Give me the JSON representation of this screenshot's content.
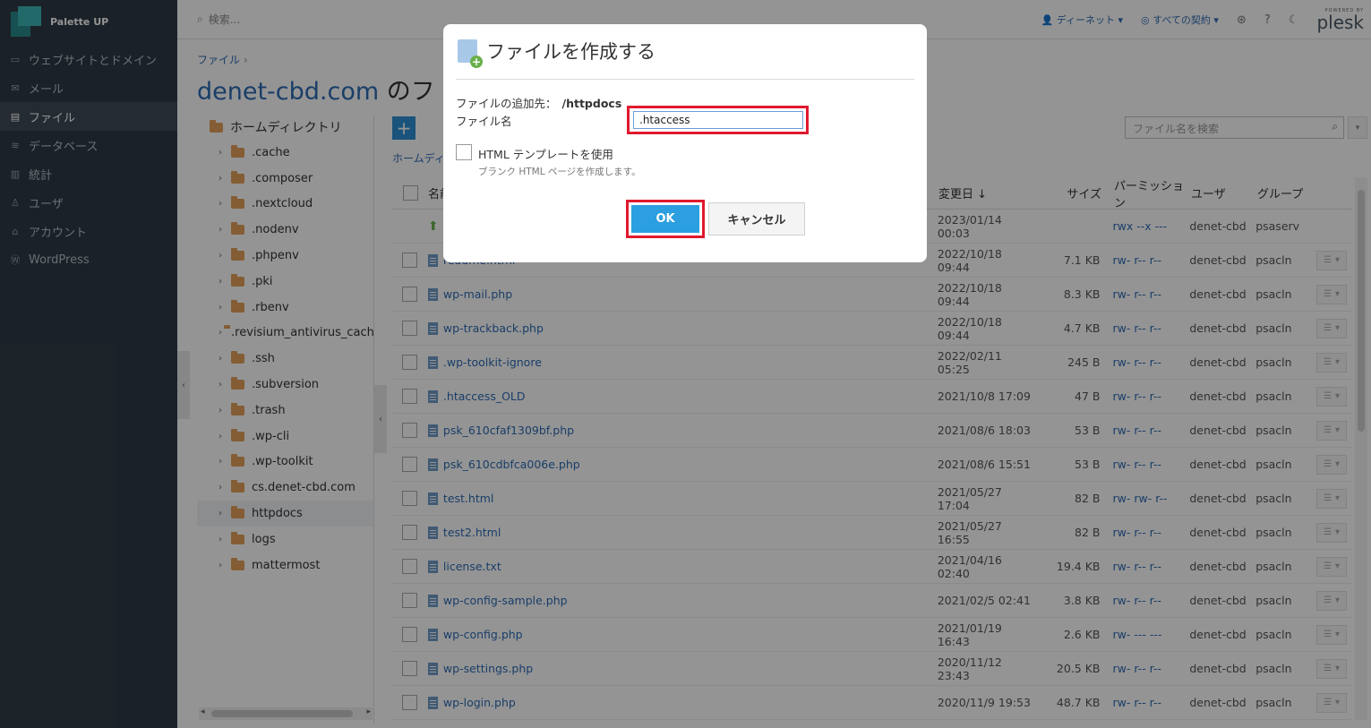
{
  "sidebar": {
    "brand": "Palette UP",
    "items": [
      {
        "icon": "monitor-icon",
        "label": "ウェブサイトとドメイン"
      },
      {
        "icon": "mail-icon",
        "label": "メール"
      },
      {
        "icon": "folder-icon",
        "label": "ファイル",
        "active": true
      },
      {
        "icon": "database-icon",
        "label": "データベース"
      },
      {
        "icon": "chart-icon",
        "label": "統計"
      },
      {
        "icon": "user-icon",
        "label": "ユーザ"
      },
      {
        "icon": "account-icon",
        "label": "アカウント"
      },
      {
        "icon": "wordpress-icon",
        "label": "WordPress"
      }
    ]
  },
  "topbar": {
    "search_placeholder": "検索...",
    "account": "ディーネット",
    "subscriptions": "すべての契約",
    "powered_by": "POWERED BY",
    "plesk": "plesk"
  },
  "main": {
    "breadcrumb": "ファイル",
    "title_domain": "denet-cbd.com",
    "title_rest": " のフ",
    "file_search_placeholder": "ファイル名を検索",
    "sub_breadcrumb": "ホームディ"
  },
  "tree": {
    "root": "ホームディレクトリ",
    "items": [
      ".cache",
      ".composer",
      ".nextcloud",
      ".nodenv",
      ".phpenv",
      ".pki",
      ".rbenv",
      ".revisium_antivirus_cach",
      ".ssh",
      ".subversion",
      ".trash",
      ".wp-cli",
      ".wp-toolkit",
      "cs.denet-cbd.com",
      "httpdocs",
      "logs",
      "mattermost"
    ],
    "selected": "httpdocs"
  },
  "table": {
    "headers": {
      "name": "名前",
      "date": "変更日 ↓",
      "size": "サイズ",
      "perm": "パーミッション",
      "user": "ユーザ",
      "group": "グループ"
    },
    "rows": [
      {
        "name": "",
        "date": "2023/01/14 00:03",
        "size": "",
        "perm": "rwx --x ---",
        "user": "denet-cbd",
        "group": "psaserv",
        "up": true
      },
      {
        "name": "readme.html",
        "date": "2022/10/18 09:44",
        "size": "7.1 KB",
        "perm": "rw- r-- r--",
        "user": "denet-cbd",
        "group": "psacln"
      },
      {
        "name": "wp-mail.php",
        "date": "2022/10/18 09:44",
        "size": "8.3 KB",
        "perm": "rw- r-- r--",
        "user": "denet-cbd",
        "group": "psacln"
      },
      {
        "name": "wp-trackback.php",
        "date": "2022/10/18 09:44",
        "size": "4.7 KB",
        "perm": "rw- r-- r--",
        "user": "denet-cbd",
        "group": "psacln"
      },
      {
        "name": ".wp-toolkit-ignore",
        "date": "2022/02/11 05:25",
        "size": "245 B",
        "perm": "rw- r-- r--",
        "user": "denet-cbd",
        "group": "psacln"
      },
      {
        "name": ".htaccess_OLD",
        "date": "2021/10/8 17:09",
        "size": "47 B",
        "perm": "rw- r-- r--",
        "user": "denet-cbd",
        "group": "psacln"
      },
      {
        "name": "psk_610cfaf1309bf.php",
        "date": "2021/08/6 18:03",
        "size": "53 B",
        "perm": "rw- r-- r--",
        "user": "denet-cbd",
        "group": "psacln"
      },
      {
        "name": "psk_610cdbfca006e.php",
        "date": "2021/08/6 15:51",
        "size": "53 B",
        "perm": "rw- r-- r--",
        "user": "denet-cbd",
        "group": "psacln"
      },
      {
        "name": "test.html",
        "date": "2021/05/27 17:04",
        "size": "82 B",
        "perm": "rw- rw- r--",
        "user": "denet-cbd",
        "group": "psacln"
      },
      {
        "name": "test2.html",
        "date": "2021/05/27 16:55",
        "size": "82 B",
        "perm": "rw- r-- r--",
        "user": "denet-cbd",
        "group": "psacln"
      },
      {
        "name": "license.txt",
        "date": "2021/04/16 02:40",
        "size": "19.4 KB",
        "perm": "rw- r-- r--",
        "user": "denet-cbd",
        "group": "psacln"
      },
      {
        "name": "wp-config-sample.php",
        "date": "2021/02/5 02:41",
        "size": "3.8 KB",
        "perm": "rw- r-- r--",
        "user": "denet-cbd",
        "group": "psacln"
      },
      {
        "name": "wp-config.php",
        "date": "2021/01/19 16:43",
        "size": "2.6 KB",
        "perm": "rw- --- ---",
        "user": "denet-cbd",
        "group": "psacln"
      },
      {
        "name": "wp-settings.php",
        "date": "2020/11/12 23:43",
        "size": "20.5 KB",
        "perm": "rw- r-- r--",
        "user": "denet-cbd",
        "group": "psacln"
      },
      {
        "name": "wp-login.php",
        "date": "2020/11/9 19:53",
        "size": "48.7 KB",
        "perm": "rw- r-- r--",
        "user": "denet-cbd",
        "group": "psacln"
      }
    ]
  },
  "modal": {
    "title": "ファイルを作成する",
    "dest_label": "ファイルの追加先：",
    "dest_value": "/httpdocs",
    "filename_label": "ファイル名",
    "filename_value": ".htaccess",
    "checkbox_label": "HTML テンプレートを使用",
    "hint": "ブランク HTML ページを作成します。",
    "ok": "OK",
    "cancel": "キャンセル"
  },
  "colors": {
    "accent": "#2b9fdf",
    "highlight": "#e0192e",
    "sidebar": "#2f3a45",
    "link": "#2d6bb4"
  }
}
